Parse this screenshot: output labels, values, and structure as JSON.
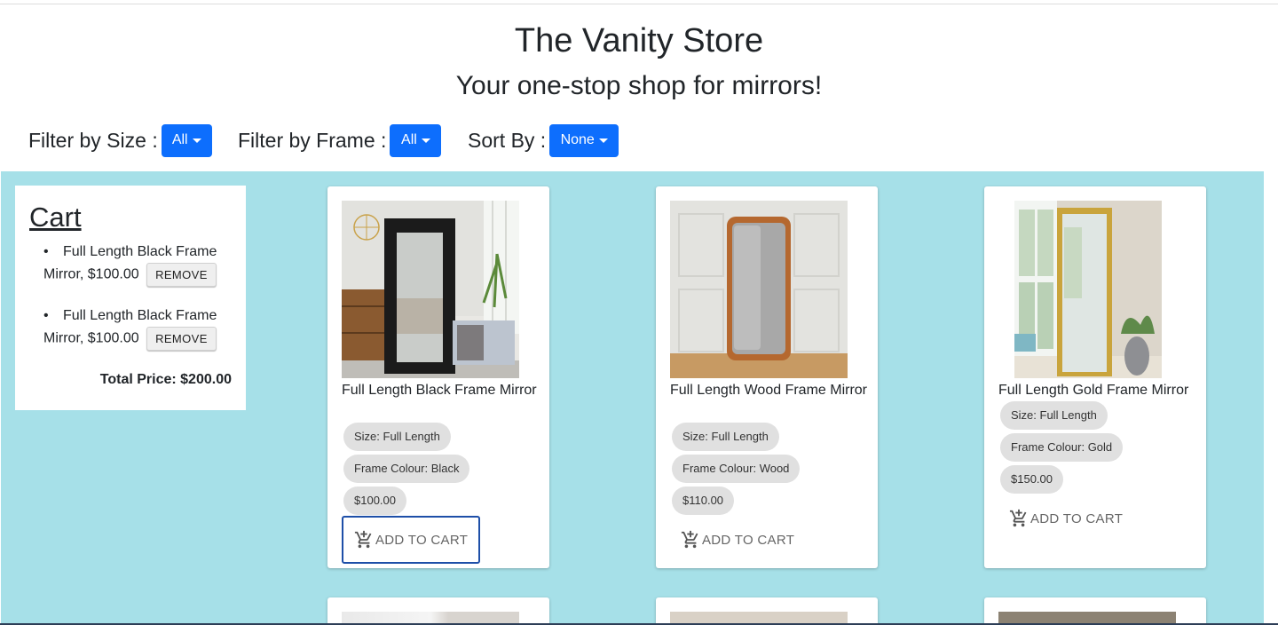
{
  "store": {
    "title": "The Vanity Store",
    "tagline": "Your one-stop shop for mirrors!"
  },
  "filters": {
    "size": {
      "label": "Filter by Size :",
      "selected": "All"
    },
    "frame": {
      "label": "Filter by Frame :",
      "selected": "All"
    },
    "sort": {
      "label": "Sort By :",
      "selected": "None"
    }
  },
  "cart": {
    "title": "Cart",
    "items": [
      {
        "line1": "Full Length Black Frame",
        "line2": "Mirror, $100.00",
        "remove_label": "REMOVE"
      },
      {
        "line1": "Full Length Black Frame",
        "line2": "Mirror, $100.00",
        "remove_label": "REMOVE"
      }
    ],
    "total": "Total Price: $200.00"
  },
  "products": [
    {
      "name": "Full Length Black Frame Mirror",
      "size": "Size: Full Length",
      "frame": "Frame Colour: Black",
      "price": "$100.00",
      "add_label": "ADD TO CART",
      "frame_color": "#1c1c1c"
    },
    {
      "name": "Full Length Wood Frame Mirror",
      "size": "Size: Full Length",
      "frame": "Frame Colour: Wood",
      "price": "$110.00",
      "add_label": "ADD TO CART",
      "frame_color": "#b5682f"
    },
    {
      "name": "Full Length Gold Frame Mirror",
      "size": "Size: Full Length",
      "frame": "Frame Colour: Gold",
      "price": "$150.00",
      "add_label": "ADD TO CART",
      "frame_color": "#c9a43c"
    }
  ],
  "colors": {
    "accent": "#0d6efd",
    "background": "#a6e0e8",
    "chip": "#e0e0e0"
  },
  "icons": {
    "add_to_cart": "add-shopping-cart-icon"
  }
}
